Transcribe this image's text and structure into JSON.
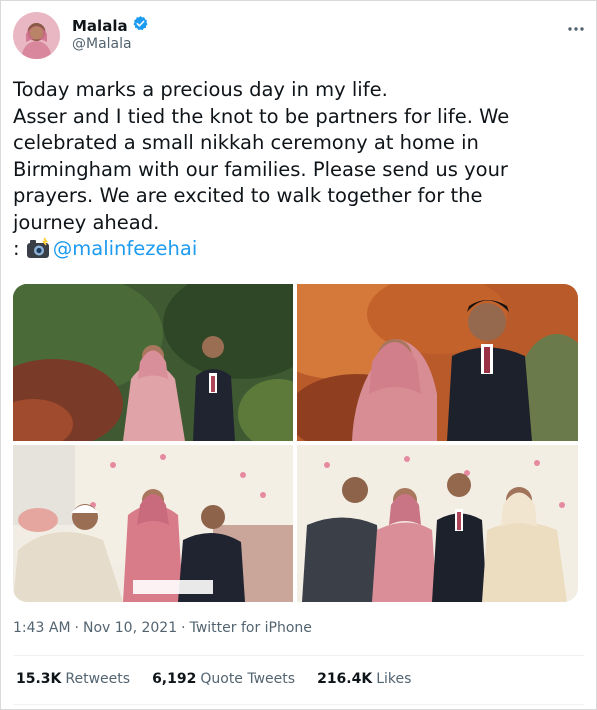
{
  "author": {
    "name": "Malala",
    "handle": "@Malala",
    "verified": true
  },
  "more_icon": "more-options-icon",
  "tweet": {
    "lines": [
      "Today marks a precious day in my life.",
      "Asser and I tied the knot to be partners for life. We",
      "celebrated a small nikkah ceremony at home in",
      "Birmingham with our families. Please send us your",
      "prayers. We are excited to walk together for the",
      "journey ahead."
    ],
    "credit_prefix": ": ",
    "credit_icon": "camera-with-flash-emoji",
    "credit_mention": "@malinfezehai"
  },
  "meta": {
    "time": "1:43 AM",
    "sep1": "·",
    "date": "Nov 10, 2021",
    "sep2": "·",
    "source": "Twitter for iPhone"
  },
  "stats": {
    "retweets_count": "15.3K",
    "retweets_label": "Retweets",
    "quotes_count": "6,192",
    "quotes_label": "Quote Tweets",
    "likes_count": "216.4K",
    "likes_label": "Likes"
  },
  "colors": {
    "accent": "#1d9bf0",
    "text": "#0f1419",
    "secondary": "#536471"
  }
}
